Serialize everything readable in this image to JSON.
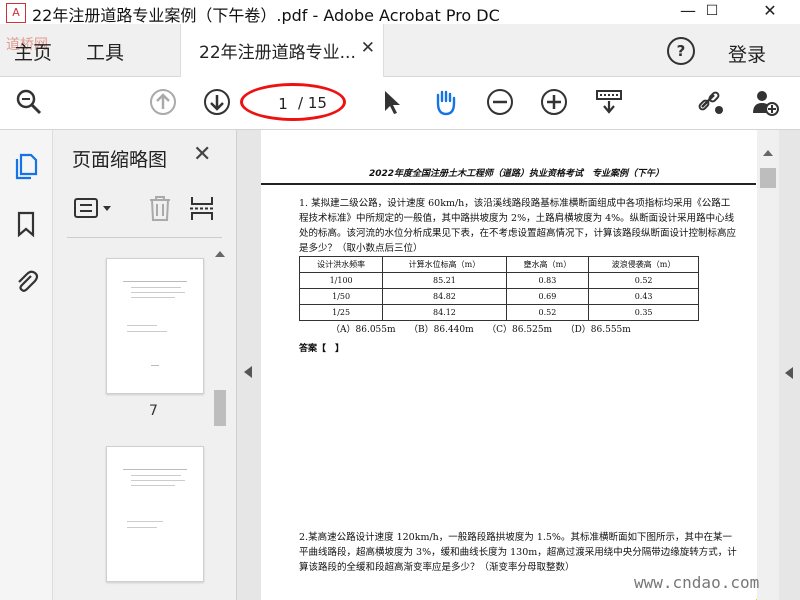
{
  "window": {
    "title": "22年注册道路专业案例（下午卷）.pdf - Adobe Acrobat Pro DC",
    "minimize": "—",
    "maximize": "☐",
    "close": "✕",
    "app_icon": "pdf-icon"
  },
  "watermark_logo": "道桥网",
  "nav": {
    "home": "主页",
    "tools": "工具",
    "doc_tab": "22年注册道路专业...",
    "doc_tab_close": "✕",
    "help": "?",
    "login": "登录"
  },
  "toolbar": {
    "page_current": "1",
    "page_total": "/ 15"
  },
  "thumbnails": {
    "title": "页面缩略图",
    "close": "✕",
    "page_label": "7"
  },
  "document": {
    "header": "2022年度全国注册土木工程师（道路）执业资格考试　专业案例（下午）",
    "q1": "1. 某拟建二级公路，设计速度 60km/h，该沿溪线路段路基标准横断面组成中各项指标均采用《公路工程技术标准》中所规定的一般值，其中路拱坡度为 2%，土路肩横坡度为 4%。纵断面设计采用路中心线处的标高。该河流的水位分析成果见下表，在不考虑设置超高情况下，计算该路段纵断面设计控制标高应是多少？（取小数点后三位）",
    "table": {
      "headers": [
        "设计洪水频率",
        "计算水位标高（m）",
        "壅水高（m）",
        "波浪侵袭高（m）"
      ],
      "rows": [
        [
          "1/100",
          "85.21",
          "0.83",
          "0.52"
        ],
        [
          "1/50",
          "84.82",
          "0.69",
          "0.43"
        ],
        [
          "1/25",
          "84.12",
          "0.52",
          "0.35"
        ]
      ]
    },
    "options": "（A）86.055m　　（B）86.440m　　（C）86.525m　　（D）86.555m",
    "answer": "答案【　】",
    "q2": "2.某高速公路设计速度 120km/h，一般路段路拱坡度为 1.5%。其标准横断面如下图所示，其中在某一平曲线路段，超高横坡度为 3%，缓和曲线长度为 130m，超高过渡采用绕中央分隔带边缘旋转方式，计算该路段的全缓和段超高渐变率应是多少？（渐变率分母取整数）"
  },
  "site_watermark": "www.cndao.com"
}
